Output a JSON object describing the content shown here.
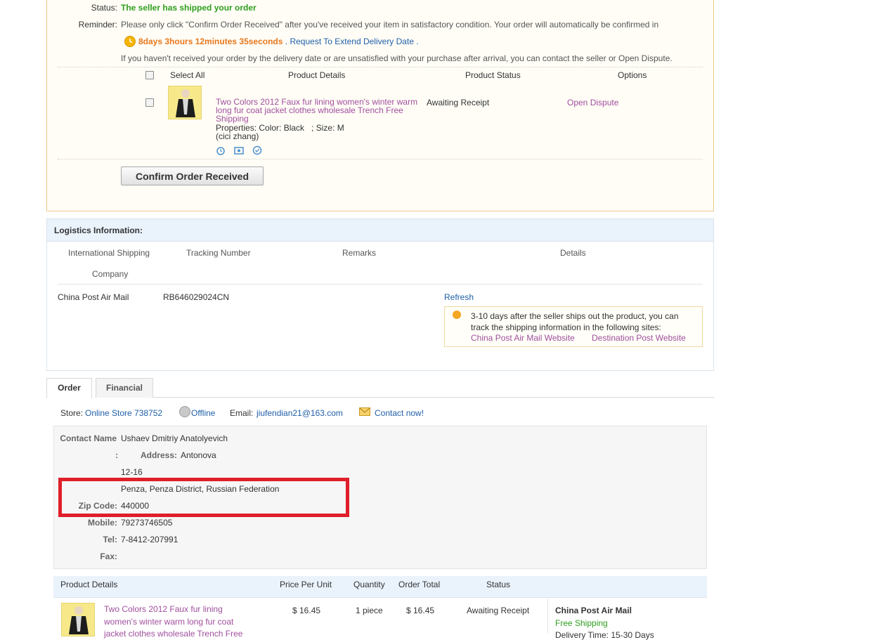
{
  "status": {
    "status_label": "Status:",
    "status_value": "The seller has shipped your order",
    "reminder_label": "Reminder:",
    "reminder_text": "Please only click \"Confirm Order Received\" after you've received your item in satisfactory condition. Your order will automatically be confirmed in",
    "countdown": "8days 3hours 12minutes 35seconds",
    "countdown_suffix": " . ",
    "extend_link": "Request To Extend Delivery Date",
    "extend_suffix": " .",
    "dispute_note": "If you haven't received your order by the delivery date or are unsatisfied with your purchase after arrival, you can contact the seller or Open Dispute.",
    "columns": {
      "select_all": "Select All",
      "product_details": "Product Details",
      "product_status": "Product Status",
      "options": "Options"
    },
    "item": {
      "title": "Two Colors 2012 Faux fur lining women's winter warm long fur coat jacket clothes wholesale Trench Free Shipping",
      "properties": "Properties: Color: Black   ; Size: M",
      "buyer": "(cici zhang)",
      "status": "Awaiting Receipt",
      "option": "Open Dispute"
    },
    "confirm_button": "Confirm Order Received"
  },
  "logistics": {
    "title": "Logistics Information:",
    "headers": {
      "company_1": "International Shipping",
      "company_2": "Company",
      "tracking": "Tracking Number",
      "remarks": "Remarks",
      "details": "Details"
    },
    "row": {
      "company": "China Post Air Mail",
      "tracking": "RB646029024CN",
      "refresh": "Refresh"
    },
    "tip": "3-10 days after the seller ships out the product, you can track the shipping information in the following sites:",
    "tip_link_1": "China Post Air Mail Website",
    "tip_link_2": "Destination Post Website"
  },
  "tabs": [
    {
      "label": "Order"
    },
    {
      "label": "Financial"
    }
  ],
  "store": {
    "store_label": "Store:",
    "store_name": "Online Store 738752",
    "online_status": "Offline",
    "email_label": "Email:",
    "email": "jiufendian21@163.com",
    "contact_link": "Contact now!"
  },
  "contact": {
    "name_label": "Contact Name",
    "name_colon": ":",
    "name": "Ushaev Dmitriy Anatolyevich",
    "address_label": "Address:",
    "address_1": "Antonova",
    "address_2": "12-16",
    "address_3": "Penza, Penza District, Russian Federation",
    "zip_label": "Zip Code:",
    "zip": "440000",
    "mobile_label": "Mobile:",
    "mobile": "79273746505",
    "tel_label": "Tel:",
    "tel": "7-8412-207991",
    "fax_label": "Fax:",
    "fax": ""
  },
  "product_table": {
    "headers": {
      "details": "Product Details",
      "price": "Price Per Unit",
      "qty": "Quantity",
      "total": "Order Total",
      "status": "Status"
    },
    "row": {
      "title_1": "Two Colors 2012 Faux fur lining",
      "title_2": "women's winter warm long fur coat",
      "title_3": "jacket clothes wholesale Trench Free",
      "price": "$ 16.45",
      "qty": "1 piece",
      "total": "$ 16.45",
      "status": "Awaiting Receipt",
      "carrier": "China Post Air Mail",
      "shipping": "Free Shipping",
      "delivery": "Delivery Time: 15-30 Days"
    }
  },
  "colors": {
    "green_status": "#2e9e1e",
    "countdown": "#e8771c",
    "link": "#1f5fa8",
    "purple": "#a04f9e",
    "highlight": "#e01f2a"
  }
}
